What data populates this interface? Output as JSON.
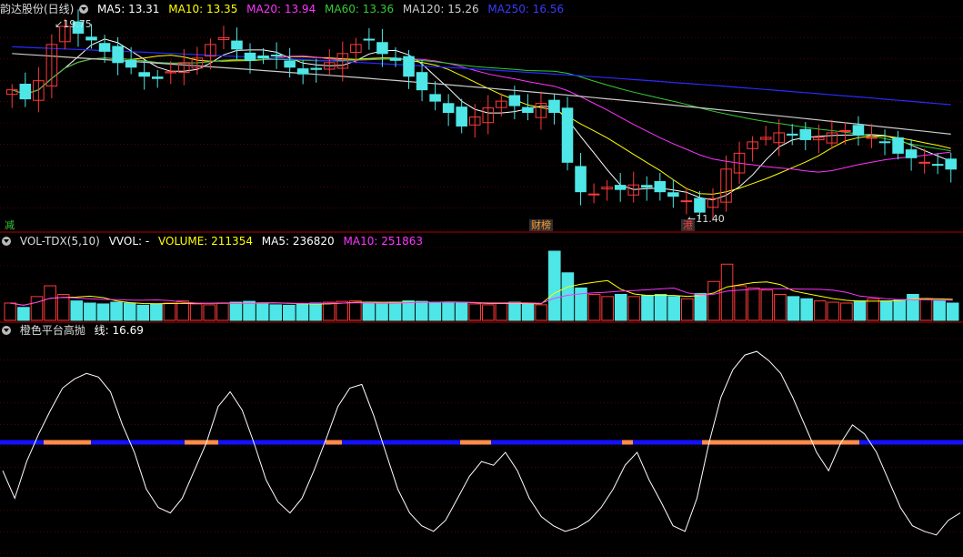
{
  "colors": {
    "background": "#000000",
    "grid": "#8b0000",
    "up": "#ff3a3a",
    "down": "#4ee6e6",
    "ma5": "#ffffff",
    "ma10": "#ffff00",
    "ma20": "#ff33ff",
    "ma60": "#33cc33",
    "ma120": "#cccccc",
    "ma250": "#2a2aff",
    "vol_up": "#ff3a3a",
    "vol_down": "#4ee6e6",
    "osc_line": "#ffffff",
    "osc_band_base": "#1212ff",
    "osc_band_hi": "#ff8c4a"
  },
  "main_panel": {
    "title": "韵达股份(日线)",
    "ma_legend": [
      {
        "label": "MA5: 13.31",
        "color": "#ffffff"
      },
      {
        "label": "MA10: 13.35",
        "color": "#ffff00"
      },
      {
        "label": "MA20: 13.94",
        "color": "#ff33ff"
      },
      {
        "label": "MA60: 13.36",
        "color": "#33cc33"
      },
      {
        "label": "MA120: 15.26",
        "color": "#cccccc"
      },
      {
        "label": "MA250: 16.56",
        "color": "#3a3aff"
      }
    ],
    "high_label": "19.75",
    "low_label": "11.40",
    "badges": [
      {
        "text": "减",
        "color": "#33cc33"
      },
      {
        "text": "财榜",
        "color": "#ff9933"
      },
      {
        "text": "港",
        "color": "#ff3a3a"
      }
    ]
  },
  "volume_panel": {
    "title": "VOL-TDX(5,10)",
    "legend": [
      {
        "label": "VVOL: -",
        "color": "#ffffff"
      },
      {
        "label": "VOLUME: 211354",
        "color": "#ffff00"
      },
      {
        "label": "MA5: 236820",
        "color": "#ffffff"
      },
      {
        "label": "MA10: 251863",
        "color": "#ff33ff"
      }
    ]
  },
  "osc_panel": {
    "title": "橙色平台高抛",
    "legend": [
      {
        "label": "线: 16.69",
        "color": "#ffffff"
      }
    ]
  },
  "chart_data": {
    "type": "candlestick",
    "ylim_price": [
      11.0,
      20.0
    ],
    "price_sketch": [
      17.0,
      16.6,
      17.4,
      19.0,
      19.8,
      19.5,
      19.2,
      18.7,
      18.2,
      18.0,
      17.6,
      17.5,
      17.8,
      18.2,
      18.4,
      19.0,
      19.3,
      18.8,
      18.3,
      18.4,
      18.5,
      18.0,
      17.7,
      17.9,
      18.2,
      18.6,
      19.0,
      19.2,
      18.6,
      18.3,
      17.6,
      17.0,
      16.5,
      16.0,
      15.4,
      15.8,
      16.2,
      16.5,
      16.3,
      16.0,
      16.4,
      16.0,
      13.8,
      12.5,
      12.4,
      12.7,
      12.6,
      12.8,
      12.7,
      12.5,
      12.3,
      12.1,
      11.6,
      12.2,
      13.5,
      14.2,
      14.7,
      14.9,
      15.1,
      15.0,
      14.8,
      14.9,
      15.1,
      15.2,
      15.0,
      14.9,
      14.7,
      14.2,
      14.0,
      13.8,
      13.7,
      13.5
    ],
    "volume_sketch": [
      40,
      30,
      55,
      80,
      60,
      45,
      40,
      38,
      42,
      40,
      35,
      38,
      40,
      45,
      38,
      36,
      40,
      42,
      44,
      40,
      36,
      35,
      38,
      40,
      42,
      44,
      45,
      40,
      38,
      42,
      45,
      44,
      40,
      42,
      40,
      38,
      36,
      40,
      42,
      38,
      36,
      160,
      110,
      75,
      60,
      55,
      60,
      55,
      58,
      60,
      55,
      50,
      62,
      90,
      130,
      80,
      75,
      70,
      60,
      55,
      50,
      45,
      42,
      40,
      45,
      50,
      45,
      48,
      60,
      50,
      45,
      40
    ],
    "osc_sketch": [
      45,
      30,
      50,
      65,
      78,
      90,
      95,
      98,
      96,
      88,
      70,
      55,
      35,
      25,
      22,
      30,
      45,
      60,
      80,
      88,
      78,
      60,
      40,
      28,
      22,
      30,
      45,
      62,
      80,
      90,
      92,
      75,
      55,
      35,
      22,
      15,
      12,
      18,
      30,
      42,
      50,
      48,
      55,
      45,
      30,
      20,
      15,
      12,
      14,
      18,
      25,
      35,
      48,
      55,
      40,
      28,
      15,
      12,
      30,
      60,
      85,
      100,
      108,
      110,
      105,
      98,
      85,
      70,
      55,
      45,
      60,
      70,
      65,
      55,
      40,
      25,
      15,
      12,
      10,
      18,
      22
    ],
    "osc_band_segments": [
      [
        48,
        100
      ],
      [
        203,
        240
      ],
      [
        358,
        376
      ],
      [
        506,
        540
      ],
      [
        684,
        696
      ],
      [
        772,
        945
      ]
    ]
  }
}
